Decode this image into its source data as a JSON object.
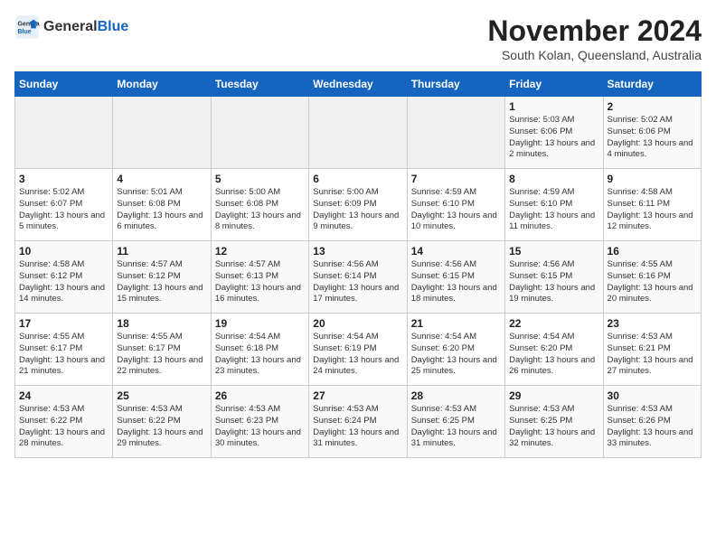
{
  "header": {
    "logo_general": "General",
    "logo_blue": "Blue",
    "month_title": "November 2024",
    "subtitle": "South Kolan, Queensland, Australia"
  },
  "days_of_week": [
    "Sunday",
    "Monday",
    "Tuesday",
    "Wednesday",
    "Thursday",
    "Friday",
    "Saturday"
  ],
  "weeks": [
    [
      {
        "day": "",
        "empty": true
      },
      {
        "day": "",
        "empty": true
      },
      {
        "day": "",
        "empty": true
      },
      {
        "day": "",
        "empty": true
      },
      {
        "day": "",
        "empty": true
      },
      {
        "day": "1",
        "sunrise": "5:03 AM",
        "sunset": "6:06 PM",
        "daylight": "13 hours and 2 minutes."
      },
      {
        "day": "2",
        "sunrise": "5:02 AM",
        "sunset": "6:06 PM",
        "daylight": "13 hours and 4 minutes."
      }
    ],
    [
      {
        "day": "3",
        "sunrise": "5:02 AM",
        "sunset": "6:07 PM",
        "daylight": "13 hours and 5 minutes."
      },
      {
        "day": "4",
        "sunrise": "5:01 AM",
        "sunset": "6:08 PM",
        "daylight": "13 hours and 6 minutes."
      },
      {
        "day": "5",
        "sunrise": "5:00 AM",
        "sunset": "6:08 PM",
        "daylight": "13 hours and 8 minutes."
      },
      {
        "day": "6",
        "sunrise": "5:00 AM",
        "sunset": "6:09 PM",
        "daylight": "13 hours and 9 minutes."
      },
      {
        "day": "7",
        "sunrise": "4:59 AM",
        "sunset": "6:10 PM",
        "daylight": "13 hours and 10 minutes."
      },
      {
        "day": "8",
        "sunrise": "4:59 AM",
        "sunset": "6:10 PM",
        "daylight": "13 hours and 11 minutes."
      },
      {
        "day": "9",
        "sunrise": "4:58 AM",
        "sunset": "6:11 PM",
        "daylight": "13 hours and 12 minutes."
      }
    ],
    [
      {
        "day": "10",
        "sunrise": "4:58 AM",
        "sunset": "6:12 PM",
        "daylight": "13 hours and 14 minutes."
      },
      {
        "day": "11",
        "sunrise": "4:57 AM",
        "sunset": "6:12 PM",
        "daylight": "13 hours and 15 minutes."
      },
      {
        "day": "12",
        "sunrise": "4:57 AM",
        "sunset": "6:13 PM",
        "daylight": "13 hours and 16 minutes."
      },
      {
        "day": "13",
        "sunrise": "4:56 AM",
        "sunset": "6:14 PM",
        "daylight": "13 hours and 17 minutes."
      },
      {
        "day": "14",
        "sunrise": "4:56 AM",
        "sunset": "6:15 PM",
        "daylight": "13 hours and 18 minutes."
      },
      {
        "day": "15",
        "sunrise": "4:56 AM",
        "sunset": "6:15 PM",
        "daylight": "13 hours and 19 minutes."
      },
      {
        "day": "16",
        "sunrise": "4:55 AM",
        "sunset": "6:16 PM",
        "daylight": "13 hours and 20 minutes."
      }
    ],
    [
      {
        "day": "17",
        "sunrise": "4:55 AM",
        "sunset": "6:17 PM",
        "daylight": "13 hours and 21 minutes."
      },
      {
        "day": "18",
        "sunrise": "4:55 AM",
        "sunset": "6:17 PM",
        "daylight": "13 hours and 22 minutes."
      },
      {
        "day": "19",
        "sunrise": "4:54 AM",
        "sunset": "6:18 PM",
        "daylight": "13 hours and 23 minutes."
      },
      {
        "day": "20",
        "sunrise": "4:54 AM",
        "sunset": "6:19 PM",
        "daylight": "13 hours and 24 minutes."
      },
      {
        "day": "21",
        "sunrise": "4:54 AM",
        "sunset": "6:20 PM",
        "daylight": "13 hours and 25 minutes."
      },
      {
        "day": "22",
        "sunrise": "4:54 AM",
        "sunset": "6:20 PM",
        "daylight": "13 hours and 26 minutes."
      },
      {
        "day": "23",
        "sunrise": "4:53 AM",
        "sunset": "6:21 PM",
        "daylight": "13 hours and 27 minutes."
      }
    ],
    [
      {
        "day": "24",
        "sunrise": "4:53 AM",
        "sunset": "6:22 PM",
        "daylight": "13 hours and 28 minutes."
      },
      {
        "day": "25",
        "sunrise": "4:53 AM",
        "sunset": "6:22 PM",
        "daylight": "13 hours and 29 minutes."
      },
      {
        "day": "26",
        "sunrise": "4:53 AM",
        "sunset": "6:23 PM",
        "daylight": "13 hours and 30 minutes."
      },
      {
        "day": "27",
        "sunrise": "4:53 AM",
        "sunset": "6:24 PM",
        "daylight": "13 hours and 31 minutes."
      },
      {
        "day": "28",
        "sunrise": "4:53 AM",
        "sunset": "6:25 PM",
        "daylight": "13 hours and 31 minutes."
      },
      {
        "day": "29",
        "sunrise": "4:53 AM",
        "sunset": "6:25 PM",
        "daylight": "13 hours and 32 minutes."
      },
      {
        "day": "30",
        "sunrise": "4:53 AM",
        "sunset": "6:26 PM",
        "daylight": "13 hours and 33 minutes."
      }
    ]
  ]
}
